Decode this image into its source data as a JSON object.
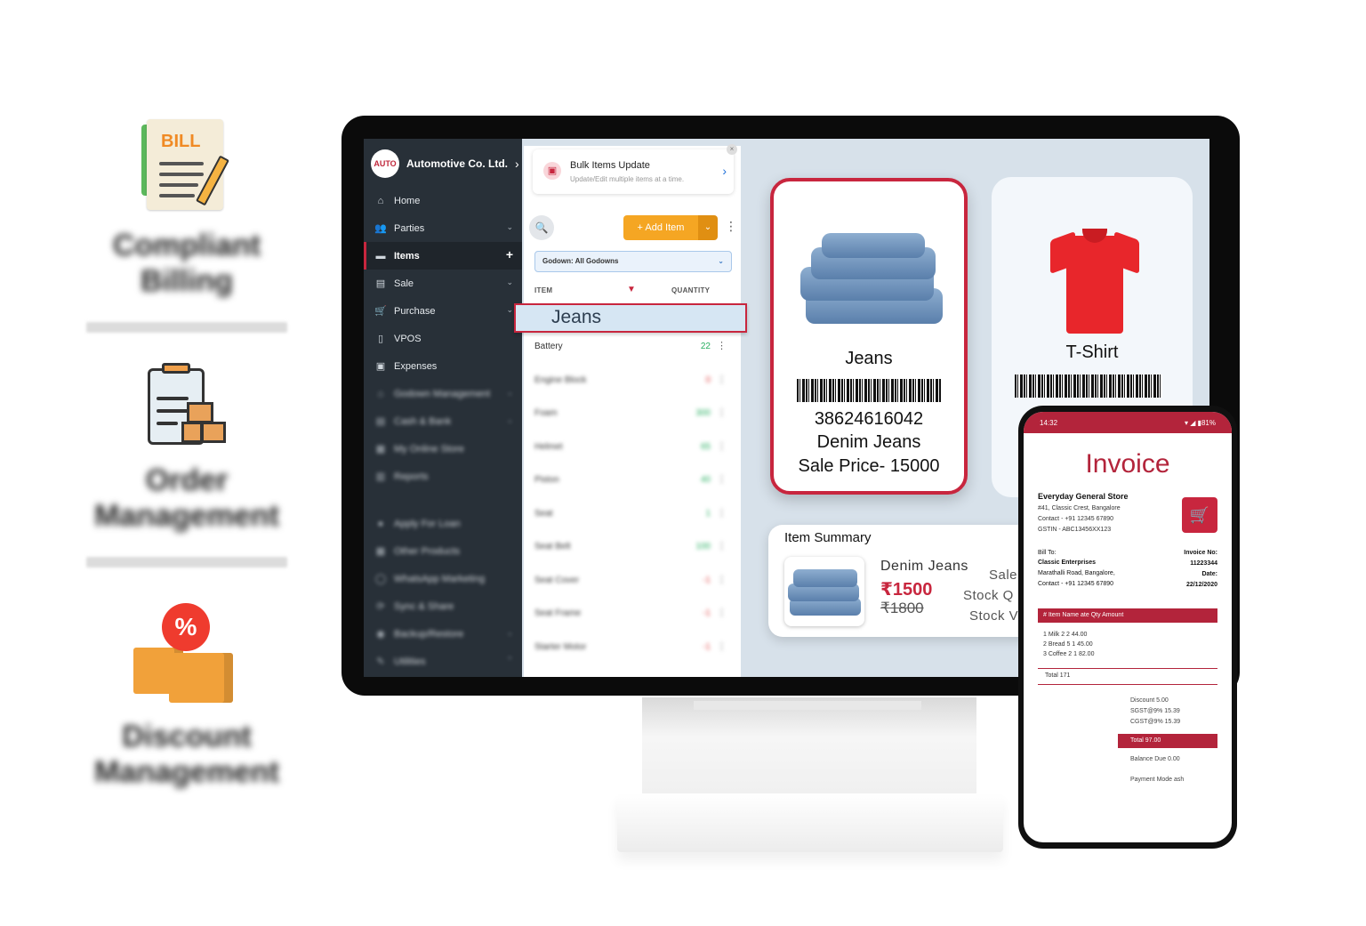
{
  "features": {
    "billing": {
      "icon": "bill-icon",
      "badge": "BILL",
      "title": "Compliant Billing"
    },
    "order": {
      "icon": "order-clipboard-icon",
      "title": "Order Management"
    },
    "discount": {
      "icon": "discount-boxes-icon",
      "badge": "%",
      "title": "Discount Management"
    }
  },
  "sidebar": {
    "company": "Automotive Co. Ltd.",
    "items": [
      {
        "label": "Home",
        "icon": "home-icon",
        "glyph": "⌂"
      },
      {
        "label": "Parties",
        "icon": "users-icon",
        "glyph": "👥",
        "caret": "⌄"
      },
      {
        "label": "Items",
        "icon": "items-icon",
        "glyph": "▬",
        "caret": "+"
      },
      {
        "label": "Sale",
        "icon": "sale-icon",
        "glyph": "▤",
        "caret": "⌄"
      },
      {
        "label": "Purchase",
        "icon": "cart-icon",
        "glyph": "🛒",
        "caret": "⌄"
      },
      {
        "label": "VPOS",
        "icon": "vpos-icon",
        "glyph": "▯"
      },
      {
        "label": "Expenses",
        "icon": "wallet-icon",
        "glyph": "▣"
      },
      {
        "label": "Godown Management",
        "icon": "godown-icon",
        "glyph": "⌂",
        "caret": "⌄"
      },
      {
        "label": "Cash & Bank",
        "icon": "bank-icon",
        "glyph": "▤",
        "caret": "⌄"
      },
      {
        "label": "My Online Store",
        "icon": "store-icon",
        "glyph": "▦"
      },
      {
        "label": "Reports",
        "icon": "reports-icon",
        "glyph": "▥"
      },
      {
        "label": "Apply For Loan",
        "icon": "loan-icon",
        "glyph": "●"
      },
      {
        "label": "Other Products",
        "icon": "products-icon",
        "glyph": "▦"
      },
      {
        "label": "WhatsApp Marketing",
        "icon": "whatsapp-icon",
        "glyph": "◯"
      },
      {
        "label": "Sync & Share",
        "icon": "sync-icon",
        "glyph": "⟳"
      },
      {
        "label": "Backup/Restore",
        "icon": "backup-icon",
        "glyph": "◉",
        "caret": "⌄"
      },
      {
        "label": "Utilities",
        "icon": "utilities-icon",
        "glyph": "✎",
        "caret": "⌃"
      }
    ]
  },
  "panel": {
    "bulk_title": "Bulk Items Update",
    "bulk_subtitle": "Update/Edit multiple items at a time.",
    "add_item": "+ Add Item",
    "godown": "Godown: All Godowns",
    "col_item": "ITEM",
    "col_quantity": "QUANTITY",
    "highlight": "Jeans",
    "rows": [
      {
        "name": "Battery",
        "qty": "22",
        "tone": "green"
      },
      {
        "name": "Engine Block",
        "qty": "0",
        "tone": "red"
      },
      {
        "name": "Foam",
        "qty": "300",
        "tone": "green"
      },
      {
        "name": "Helmet",
        "qty": "65",
        "tone": "green"
      },
      {
        "name": "Piston",
        "qty": "40",
        "tone": "green"
      },
      {
        "name": "Seat",
        "qty": "1",
        "tone": "green"
      },
      {
        "name": "Seat Belt",
        "qty": "100",
        "tone": "green"
      },
      {
        "name": "Seat Cover",
        "qty": "-1",
        "tone": "red"
      },
      {
        "name": "Seat Frame",
        "qty": "-1",
        "tone": "red"
      },
      {
        "name": "Starter Motor",
        "qty": "-1",
        "tone": "red"
      }
    ]
  },
  "cards": {
    "jeans": {
      "title": "Jeans",
      "code": "38624616042",
      "name": "Denim Jeans",
      "price": "Sale Price- 15000"
    },
    "tshirt": {
      "title": "T-Shirt"
    }
  },
  "summary": {
    "title": "Item Summary",
    "name": "Denim Jeans",
    "price": "₹1500",
    "old_price": "₹1800",
    "label1": "Sale",
    "label2": "Stock Q",
    "label3": "Stock V"
  },
  "invoice": {
    "time": "14:32",
    "status_icons": "▾ ◢ ▮81%",
    "title": "Invoice",
    "store": "Everyday General Store",
    "addr1": "#41, Classic Crest, Bangalore",
    "addr2": "Contact - +91 12345 67890",
    "addr3": "GSTIN - ABC13456XX123",
    "billto_label": "Bill To:",
    "billto_name": "Classic Enterprises",
    "billto_addr": "Marathalli Road, Bangalore,",
    "billto_contact": "Contact - +91 12345 67890",
    "inv_no_label": "Invoice No:",
    "inv_no": "11223344",
    "date_label": "Date:",
    "date": "22/12/2020",
    "table_head": "# Item Name ate Qty Amount",
    "lines": [
      "1 Milk 2 2 44.00",
      "2 Bread 5 1 45.00",
      "3 Coffee 2 1 82.00"
    ],
    "total": "Total  171",
    "discount": "Discount 5.00",
    "sgst": "SGST@9% 15.39",
    "cgst": "CGST@9% 15.39",
    "grand_total": "Total 97.00",
    "balance": "Balance Due 0.00",
    "payment": "Payment Mode ash"
  }
}
